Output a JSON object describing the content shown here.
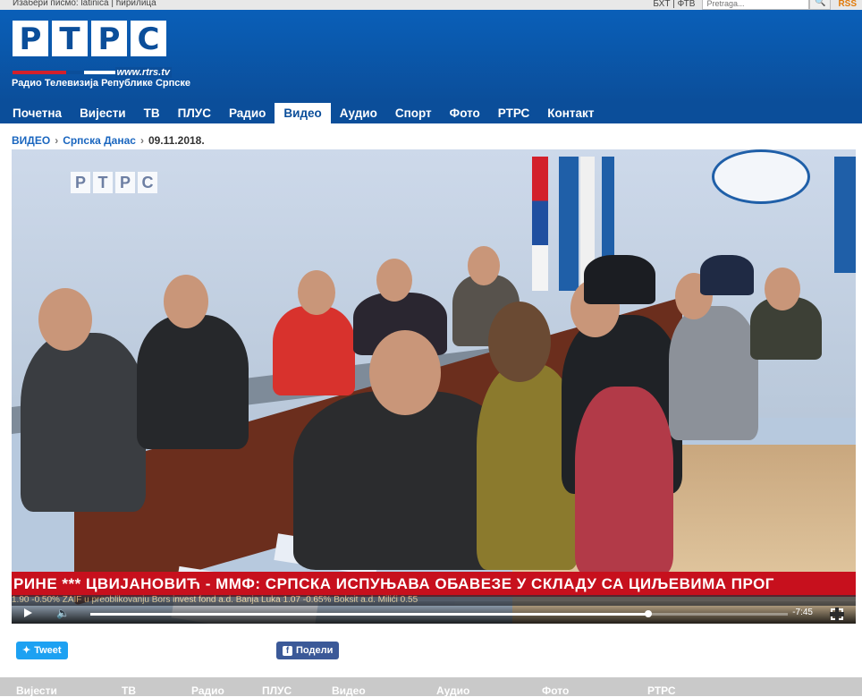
{
  "topbar": {
    "script_label": "Изабери писмо: latinica | ћирилица",
    "tv_links": "БХТ | ФТВ",
    "search_placeholder": "Pretraga...",
    "search_icon": "search-icon",
    "rss": "RSS"
  },
  "logo": {
    "letters": [
      "Р",
      "Т",
      "Р",
      "С"
    ],
    "url": "www.rtrs.tv",
    "tagline": "Радио Телевизија Републике Српске"
  },
  "nav": {
    "items": [
      "Почетна",
      "Вијести",
      "ТВ",
      "ПЛУС",
      "Радио",
      "Видео",
      "Аудио",
      "Спорт",
      "Фото",
      "РТРС",
      "Контакт"
    ],
    "active": "Видео"
  },
  "breadcrumb": {
    "section": "ВИДЕО",
    "show": "Српска Данас",
    "date": "09.11.2018."
  },
  "video": {
    "watermark": [
      "Р",
      "Т",
      "Р",
      "С"
    ],
    "ticker": "РИНЕ *** ЦВИЈАНОВИЋ - ММФ: СРПСКА ИСПУЊАВА ОБАВЕЗЕ У СКЛАДУ СА ЦИЉЕВИМА ПРОГ",
    "ticker2": "1.90 -0.50%     ZAIF u preoblikovanju Bors invest fond a.d. Banja Luka     1.07 -0.65%     Boksit a.d. Milići     0.55",
    "time_remaining": "-7:45",
    "progress_fraction": 0.8
  },
  "share": {
    "tweet": "Tweet",
    "facebook": "Подели"
  },
  "footer": {
    "items": [
      "Вијести",
      "ТВ",
      "Радио",
      "ПЛУС",
      "Видео",
      "Аудио",
      "Фото",
      "РТРС"
    ]
  },
  "colors": {
    "brand_blue": "#0b4e9a",
    "ticker_red": "#c7101d",
    "link_blue": "#1a66bf"
  }
}
